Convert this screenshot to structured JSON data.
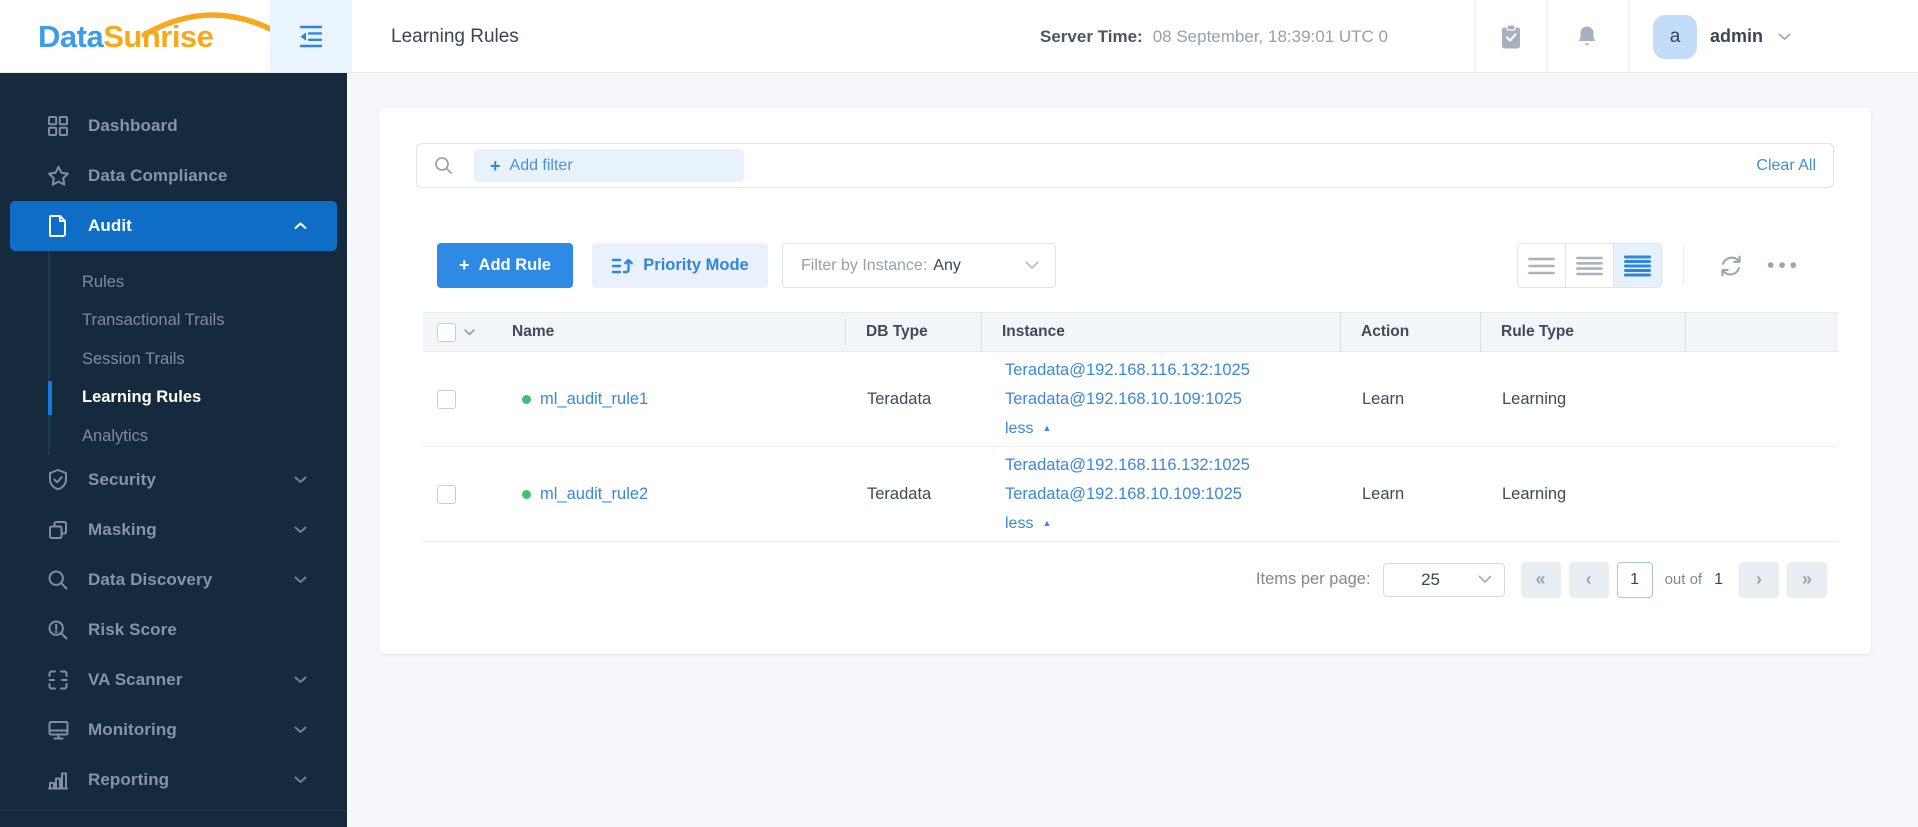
{
  "brand": {
    "word1": "Data",
    "word2": "Sunrise"
  },
  "topbar": {
    "title": "Learning Rules",
    "server_time": {
      "label": "Server Time:",
      "value": "08 September, 18:39:01  UTC 0"
    },
    "user": {
      "initial": "a",
      "name": "admin"
    }
  },
  "sidebar": {
    "items": [
      {
        "label": "Dashboard",
        "icon": "dashboard-grid-icon"
      },
      {
        "label": "Data Compliance",
        "icon": "star-icon"
      },
      {
        "label": "Audit",
        "icon": "document-icon",
        "active": true,
        "expanded": true,
        "children": [
          {
            "label": "Rules",
            "active": false
          },
          {
            "label": "Transactional Trails",
            "active": false
          },
          {
            "label": "Session Trails",
            "active": false
          },
          {
            "label": "Learning Rules",
            "active": true
          },
          {
            "label": "Analytics",
            "active": false
          }
        ]
      },
      {
        "label": "Security",
        "icon": "shield-check-icon",
        "chevron": "down"
      },
      {
        "label": "Masking",
        "icon": "masking-squares-icon",
        "chevron": "down"
      },
      {
        "label": "Data Discovery",
        "icon": "magnifier-icon",
        "chevron": "down"
      },
      {
        "label": "Risk Score",
        "icon": "magnifier-alert-icon"
      },
      {
        "label": "VA Scanner",
        "icon": "scanner-frame-icon",
        "chevron": "down"
      },
      {
        "label": "Monitoring",
        "icon": "monitor-icon",
        "chevron": "down"
      },
      {
        "label": "Reporting",
        "icon": "bar-chart-icon",
        "chevron": "down"
      }
    ]
  },
  "filter_bar": {
    "add_filter_label": "Add filter",
    "clear_all_label": "Clear All"
  },
  "toolbar": {
    "add_rule_label": "Add Rule",
    "priority_mode_label": "Priority Mode",
    "instance_filter": {
      "label": "Filter by Instance:",
      "value": "Any"
    }
  },
  "table": {
    "columns": [
      "Name",
      "DB Type",
      "Instance",
      "Action",
      "Rule Type"
    ],
    "rows": [
      {
        "name": "ml_audit_rule1",
        "db_type": "Teradata",
        "instances": [
          "Teradata@192.168.116.132:1025",
          "Teradata@192.168.10.109:1025"
        ],
        "collapse_label": "less",
        "action": "Learn",
        "rule_type": "Learning"
      },
      {
        "name": "ml_audit_rule2",
        "db_type": "Teradata",
        "instances": [
          "Teradata@192.168.116.132:1025",
          "Teradata@192.168.10.109:1025"
        ],
        "collapse_label": "less",
        "action": "Learn",
        "rule_type": "Learning"
      }
    ]
  },
  "pagination": {
    "items_per_page_label": "Items per page:",
    "page_size": "25",
    "current_page": "1",
    "out_of_label": "out of",
    "total_pages": "1"
  },
  "icons": {
    "plus": "+",
    "ellipsis": "•••",
    "first": "«",
    "prev": "‹",
    "next": "›",
    "last": "»",
    "less_triangle": "▲"
  },
  "colors": {
    "accent_blue": "#2e86e0",
    "active_nav_blue": "#0e6ec5",
    "link_blue": "#3a87db",
    "sidebar_bg": "#162a3d",
    "status_green": "#3fc06f",
    "logo_blue": "#3d9be9",
    "logo_orange": "#f7a81b"
  }
}
